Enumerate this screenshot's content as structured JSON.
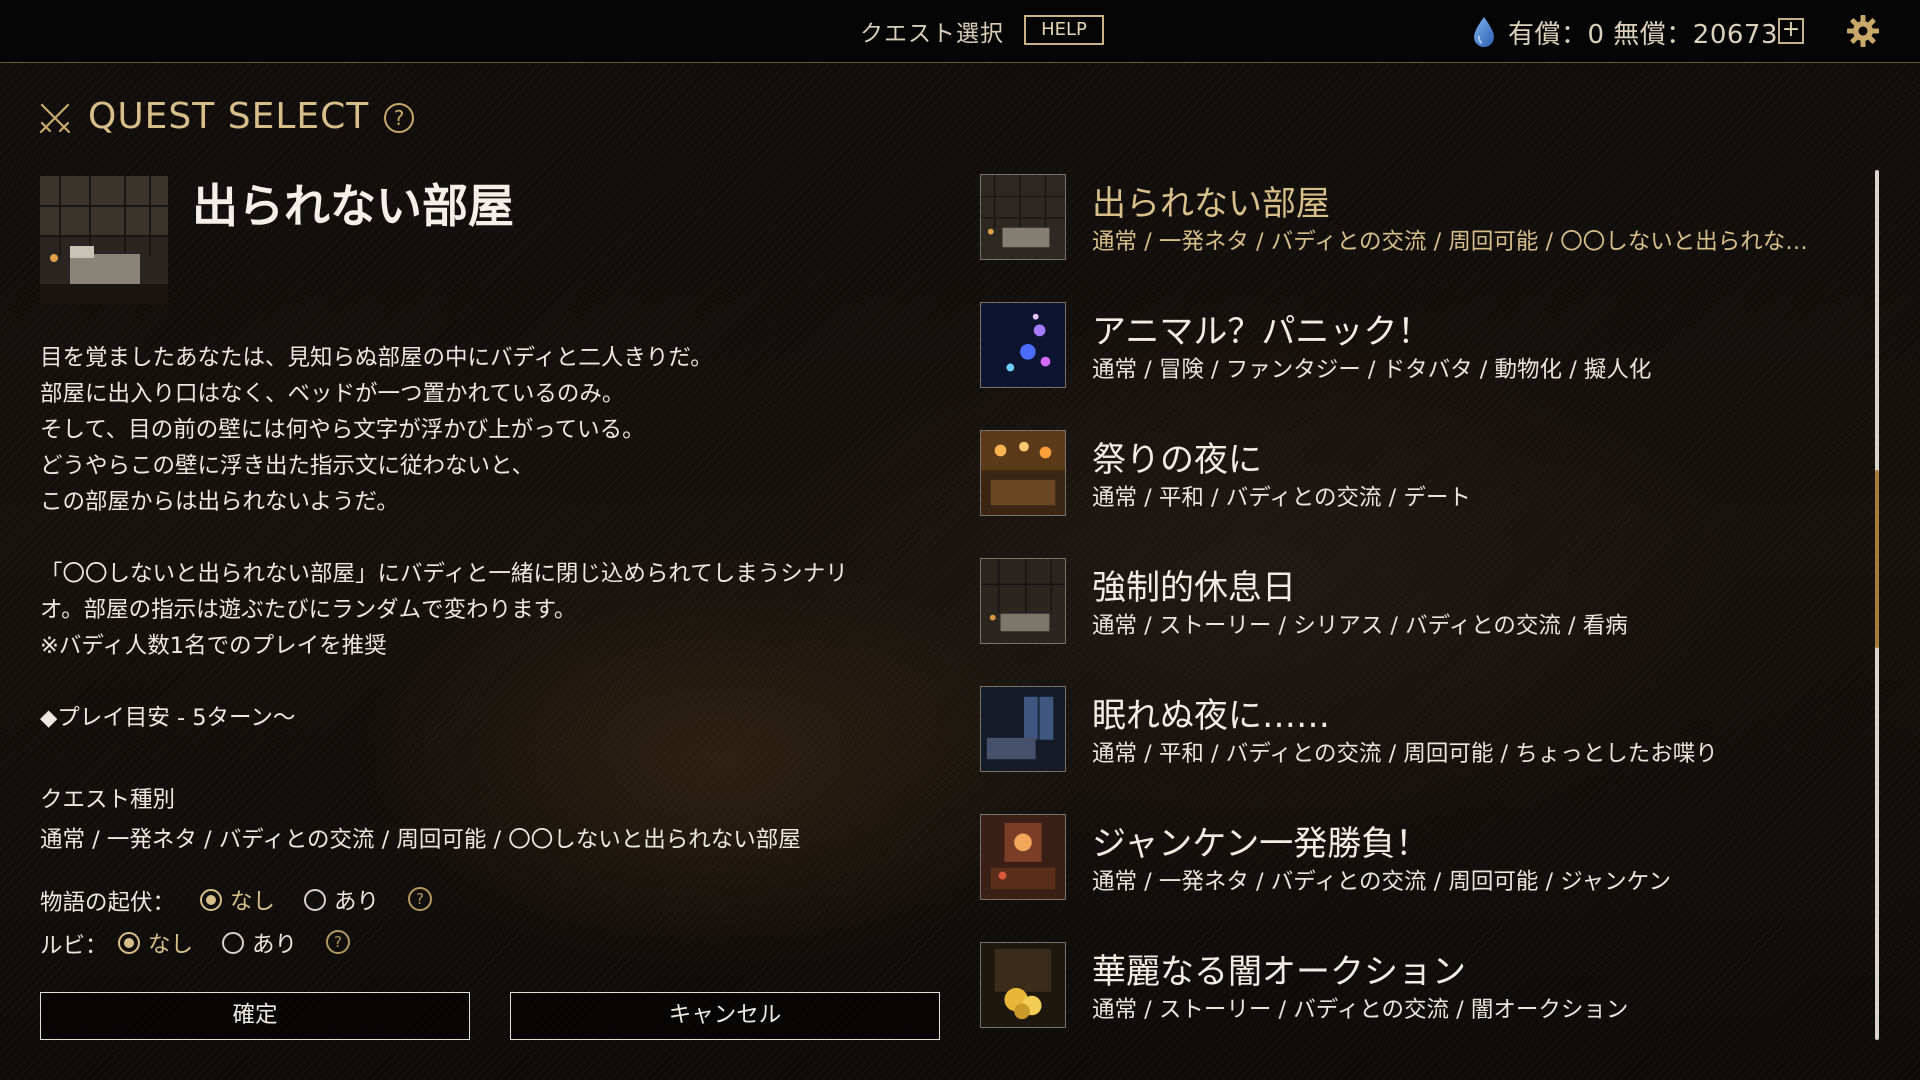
{
  "topbar": {
    "title": "クエスト選択",
    "help_label": "HELP",
    "currency_text": "有償：0 無償：20673",
    "plus_label": "+"
  },
  "header": {
    "title": "QUEST SELECT",
    "help_mark": "?"
  },
  "detail": {
    "name": "出られない部屋",
    "description": [
      "目を覚ましたあなたは、見知らぬ部屋の中にバディと二人きりだ。",
      "部屋に出入り口はなく、ベッドが一つ置かれているのみ。",
      "そして、目の前の壁には何やら文字が浮かび上がっている。",
      "どうやらこの壁に浮き出た指示文に従わないと、",
      "この部屋からは出られないようだ。",
      "「〇〇しないと出られない部屋」にバディと一緒に閉じ込められてしまうシナリ",
      "オ。部屋の指示は遊ぶたびにランダムで変わります。",
      "※バディ人数1名でのプレイを推奨"
    ],
    "playtime": "◆プレイ目安 - 5ターン～",
    "kind_label": "クエスト種別",
    "kind_value": "通常 / 一発ネタ / バディとの交流 / 周回可能 / 〇〇しないと出られない部屋"
  },
  "options": {
    "story": {
      "label": "物語の起伏：",
      "choices": [
        "なし",
        "あり"
      ],
      "selected": "なし",
      "help_mark": "?"
    },
    "ruby": {
      "label": "ルビ：",
      "choices": [
        "なし",
        "あり"
      ],
      "selected": "なし",
      "help_mark": "?"
    }
  },
  "buttons": {
    "confirm": "確定",
    "cancel": "キャンセル"
  },
  "quests": [
    {
      "name": "出られない部屋",
      "tags": "通常 / 一発ネタ / バディとの交流 / 周回可能 / 〇〇しないと出られな…",
      "selected": true
    },
    {
      "name": "アニマル？パニック！",
      "tags": "通常 / 冒険 / ファンタジー / ドタバタ / 動物化 / 擬人化",
      "selected": false
    },
    {
      "name": "祭りの夜に",
      "tags": "通常 / 平和 / バディとの交流 / デート",
      "selected": false
    },
    {
      "name": "強制的休息日",
      "tags": "通常 / ストーリー / シリアス / バディとの交流 / 看病",
      "selected": false
    },
    {
      "name": "眠れぬ夜に……",
      "tags": "通常 / 平和 / バディとの交流 / 周回可能 / ちょっとしたお喋り",
      "selected": false
    },
    {
      "name": "ジャンケン一発勝負！",
      "tags": "通常 / 一発ネタ / バディとの交流 / 周回可能 / ジャンケン",
      "selected": false
    },
    {
      "name": "華麗なる闇オークション",
      "tags": "通常 / ストーリー / バディとの交流 / 闇オークション",
      "selected": false
    }
  ],
  "colors": {
    "accent_gold": "#d8bf8a",
    "scroll_thumb": "#a87b3b",
    "currency_drop": "#4a86d8"
  }
}
